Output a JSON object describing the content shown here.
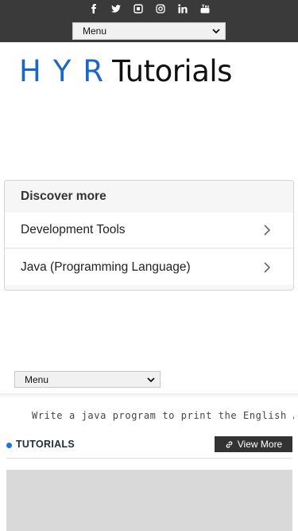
{
  "header": {
    "social_icons": [
      {
        "name": "facebook-icon",
        "glyph": "f"
      },
      {
        "name": "twitter-icon",
        "glyph": "twitter"
      },
      {
        "name": "instagram-alt-icon",
        "glyph": "square"
      },
      {
        "name": "instagram-icon",
        "glyph": "camera"
      },
      {
        "name": "linkedin-icon",
        "glyph": "in"
      },
      {
        "name": "youtube-icon",
        "glyph": "You"
      }
    ],
    "menu_label": "Menu"
  },
  "logo": {
    "part1": "HYR",
    "part2": "Tutorials"
  },
  "discover": {
    "title": "Discover more",
    "items": [
      {
        "label": "Development Tools"
      },
      {
        "label": "Java (Programming Language)"
      }
    ]
  },
  "nav": {
    "menu_label": "Menu"
  },
  "ticker": {
    "text": "Write a java program to print the English Alphabet in"
  },
  "tutorials": {
    "title": "TUTORIALS",
    "view_more": "View More"
  },
  "colors": {
    "topbar": "#3a3a3a",
    "brand_blue": "#1a67c4",
    "button_dark": "#333333"
  }
}
